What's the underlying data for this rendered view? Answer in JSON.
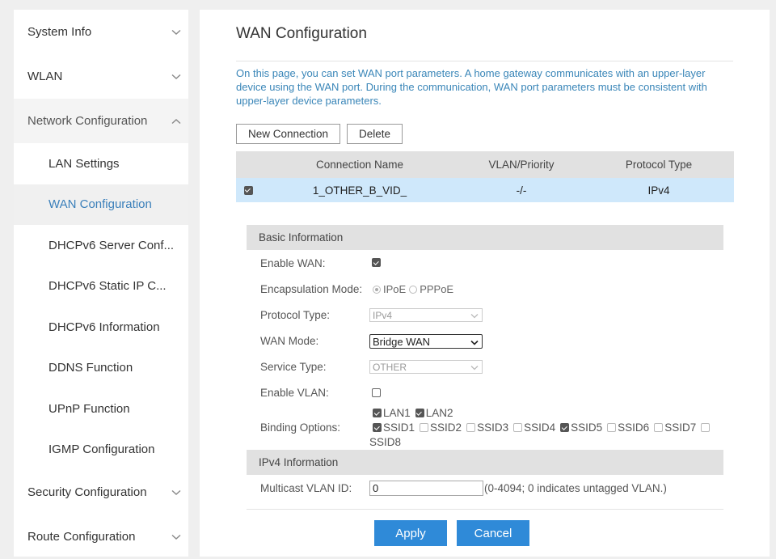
{
  "sidebar": {
    "items": [
      {
        "label": "System Info"
      },
      {
        "label": "WLAN"
      },
      {
        "label": "Network Configuration"
      },
      {
        "label": "LAN Settings"
      },
      {
        "label": "WAN Configuration"
      },
      {
        "label": "DHCPv6 Server Conf..."
      },
      {
        "label": "DHCPv6 Static IP C..."
      },
      {
        "label": "DHCPv6 Information"
      },
      {
        "label": "DDNS Function"
      },
      {
        "label": "UPnP Function"
      },
      {
        "label": "IGMP Configuration"
      },
      {
        "label": "Security Configuration"
      },
      {
        "label": "Route Configuration"
      }
    ]
  },
  "main": {
    "title": "WAN Configuration",
    "description": "On this page, you can set WAN port parameters. A home gateway communicates with an upper-layer device using the WAN port. During the communication, WAN port parameters must be consistent with upper-layer device parameters.",
    "new_connection_label": "New Connection",
    "delete_label": "Delete",
    "table": {
      "headers": [
        "Connection Name",
        "VLAN/Priority",
        "Protocol Type"
      ],
      "rows": [
        {
          "checked": true,
          "name": "1_OTHER_B_VID_",
          "vlan": "-/-",
          "protocol": "IPv4"
        }
      ]
    },
    "basic": {
      "header": "Basic Information",
      "enable_wan_label": "Enable WAN:",
      "enable_wan": true,
      "encap_label": "Encapsulation Mode:",
      "encap_ipoe": "IPoE",
      "encap_pppoe": "PPPoE",
      "protocol_type_label": "Protocol Type:",
      "protocol_type_value": "IPv4",
      "wan_mode_label": "WAN Mode:",
      "wan_mode_value": "Bridge WAN",
      "service_type_label": "Service Type:",
      "service_type_value": "OTHER",
      "enable_vlan_label": "Enable VLAN:",
      "enable_vlan": false,
      "binding_label": "Binding Options:",
      "binding": {
        "lan1": "LAN1",
        "lan2": "LAN2",
        "ssid1": "SSID1",
        "ssid2": "SSID2",
        "ssid3": "SSID3",
        "ssid4": "SSID4",
        "ssid5": "SSID5",
        "ssid6": "SSID6",
        "ssid7": "SSID7",
        "ssid8": "SSID8"
      }
    },
    "ipv4": {
      "header": "IPv4 Information",
      "multicast_label": "Multicast VLAN ID:",
      "multicast_value": "0",
      "multicast_hint": "(0-4094; 0 indicates untagged VLAN.)"
    },
    "apply_label": "Apply",
    "cancel_label": "Cancel"
  },
  "colors": {
    "accent": "#2f8ad8",
    "description_text": "#3a86b8",
    "selected_row": "#cfe8fb",
    "active_nav": "#3a7fba"
  },
  "icons": {
    "collapsed": "chevron-down-icon",
    "expanded": "chevron-up-icon"
  }
}
